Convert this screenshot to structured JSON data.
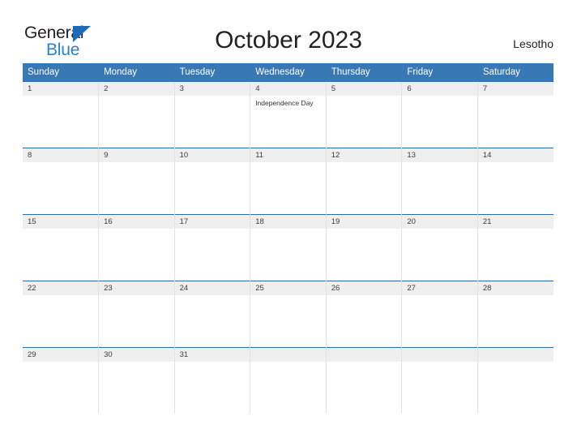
{
  "brand": {
    "line1": "General",
    "line2": "Blue",
    "triangle_icon": "triangle-icon",
    "accent_color": "#2b7fd4"
  },
  "header": {
    "title": "October 2023",
    "country": "Lesotho"
  },
  "theme": {
    "header_blue": "#3878b5",
    "row_divider_blue": "#2b6ca8",
    "date_band_gray": "#efefef",
    "page_background": "#ffffff"
  },
  "weekday_headers": [
    "Sunday",
    "Monday",
    "Tuesday",
    "Wednesday",
    "Thursday",
    "Friday",
    "Saturday"
  ],
  "weeks": [
    [
      {
        "day": "1",
        "events": []
      },
      {
        "day": "2",
        "events": []
      },
      {
        "day": "3",
        "events": []
      },
      {
        "day": "4",
        "events": [
          "Independence Day"
        ]
      },
      {
        "day": "5",
        "events": []
      },
      {
        "day": "6",
        "events": []
      },
      {
        "day": "7",
        "events": []
      }
    ],
    [
      {
        "day": "8",
        "events": []
      },
      {
        "day": "9",
        "events": []
      },
      {
        "day": "10",
        "events": []
      },
      {
        "day": "11",
        "events": []
      },
      {
        "day": "12",
        "events": []
      },
      {
        "day": "13",
        "events": []
      },
      {
        "day": "14",
        "events": []
      }
    ],
    [
      {
        "day": "15",
        "events": []
      },
      {
        "day": "16",
        "events": []
      },
      {
        "day": "17",
        "events": []
      },
      {
        "day": "18",
        "events": []
      },
      {
        "day": "19",
        "events": []
      },
      {
        "day": "20",
        "events": []
      },
      {
        "day": "21",
        "events": []
      }
    ],
    [
      {
        "day": "22",
        "events": []
      },
      {
        "day": "23",
        "events": []
      },
      {
        "day": "24",
        "events": []
      },
      {
        "day": "25",
        "events": []
      },
      {
        "day": "26",
        "events": []
      },
      {
        "day": "27",
        "events": []
      },
      {
        "day": "28",
        "events": []
      }
    ],
    [
      {
        "day": "29",
        "events": []
      },
      {
        "day": "30",
        "events": []
      },
      {
        "day": "31",
        "events": []
      },
      {
        "day": "",
        "events": []
      },
      {
        "day": "",
        "events": []
      },
      {
        "day": "",
        "events": []
      },
      {
        "day": "",
        "events": []
      }
    ]
  ]
}
